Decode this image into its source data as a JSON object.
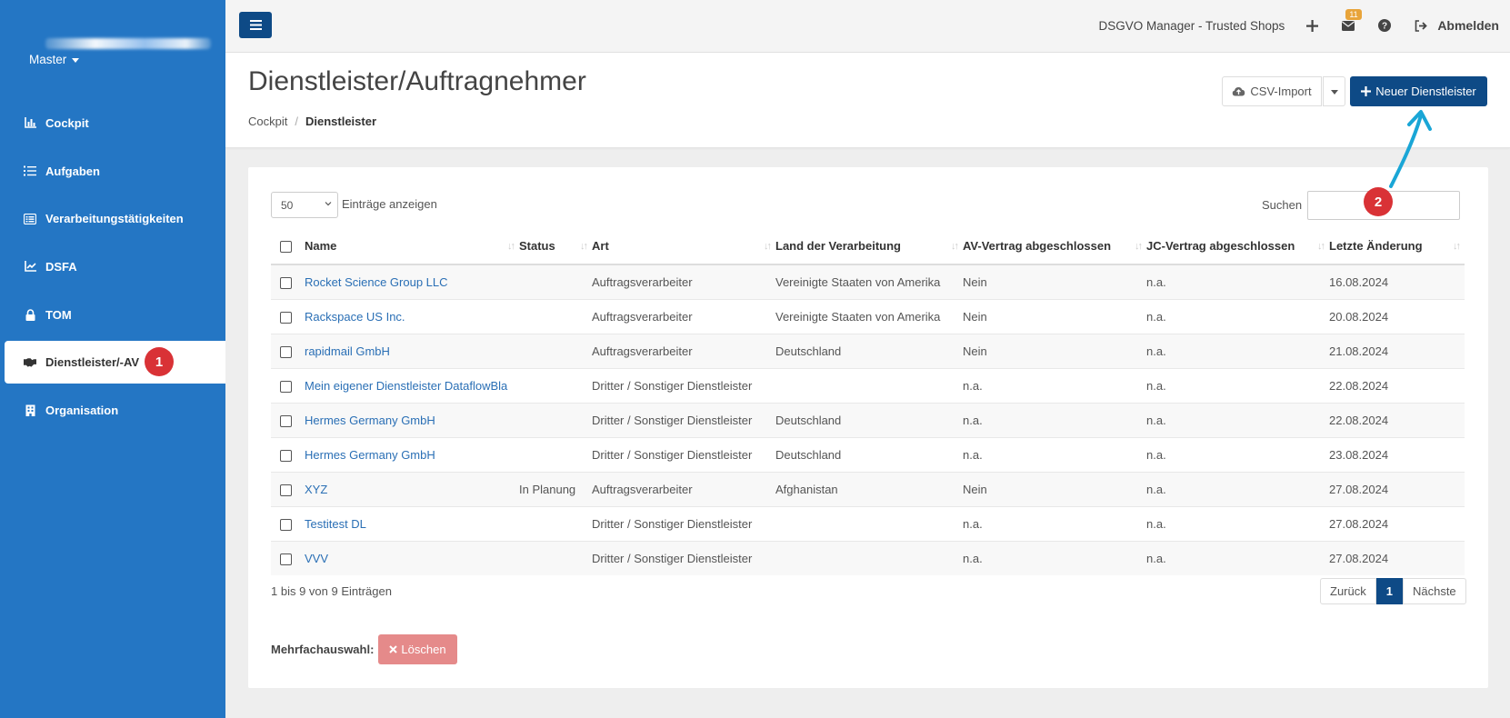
{
  "sidebar": {
    "account": "Master",
    "items": [
      {
        "label": "Cockpit",
        "icon": "chart-bar-icon"
      },
      {
        "label": "Aufgaben",
        "icon": "list-check-icon"
      },
      {
        "label": "Verarbeitungstätigkeiten",
        "icon": "list-icon"
      },
      {
        "label": "DSFA",
        "icon": "chart-line-icon"
      },
      {
        "label": "TOM",
        "icon": "lock-icon"
      },
      {
        "label": "Dienstleister/-AV",
        "icon": "handshake-icon",
        "active": true
      },
      {
        "label": "Organisation",
        "icon": "building-icon"
      }
    ],
    "step_badge": "1"
  },
  "topbar": {
    "app_link": "DSGVO Manager - Trusted Shops",
    "mail_count": "11",
    "logout_label": "Abmelden"
  },
  "header": {
    "title": "Dienstleister/Auftragnehmer",
    "breadcrumb": {
      "home": "Cockpit",
      "separator": "/",
      "current": "Dienstleister"
    },
    "csv_label": "CSV-Import",
    "new_label": "Neuer Dienstleister",
    "step_badge": "2"
  },
  "table_controls": {
    "page_length": "50",
    "page_length_label": "Einträge anzeigen",
    "search_label": "Suchen"
  },
  "table": {
    "columns": [
      "Name",
      "Status",
      "Art",
      "Land der Verarbeitung",
      "AV-Vertrag abgeschlossen",
      "JC-Vertrag abgeschlossen",
      "Letzte Änderung"
    ],
    "rows": [
      [
        "Rocket Science Group LLC",
        "",
        "Auftragsverarbeiter",
        "Vereinigte Staaten von Amerika",
        "Nein",
        "n.a.",
        "16.08.2024"
      ],
      [
        "Rackspace US Inc.",
        "",
        "Auftragsverarbeiter",
        "Vereinigte Staaten von Amerika",
        "Nein",
        "n.a.",
        "20.08.2024"
      ],
      [
        "rapidmail GmbH",
        "",
        "Auftragsverarbeiter",
        "Deutschland",
        "Nein",
        "n.a.",
        "21.08.2024"
      ],
      [
        "Mein eigener Dienstleister DataflowBla",
        "",
        "Dritter / Sonstiger Dienstleister",
        "",
        "n.a.",
        "n.a.",
        "22.08.2024"
      ],
      [
        "Hermes Germany GmbH",
        "",
        "Dritter / Sonstiger Dienstleister",
        "Deutschland",
        "n.a.",
        "n.a.",
        "22.08.2024"
      ],
      [
        "Hermes Germany GmbH",
        "",
        "Dritter / Sonstiger Dienstleister",
        "Deutschland",
        "n.a.",
        "n.a.",
        "23.08.2024"
      ],
      [
        "XYZ",
        "In Planung",
        "Auftragsverarbeiter",
        "Afghanistan",
        "Nein",
        "n.a.",
        "27.08.2024"
      ],
      [
        "Testitest DL",
        "",
        "Dritter / Sonstiger Dienstleister",
        "",
        "n.a.",
        "n.a.",
        "27.08.2024"
      ],
      [
        "VVV",
        "",
        "Dritter / Sonstiger Dienstleister",
        "",
        "n.a.",
        "n.a.",
        "27.08.2024"
      ]
    ]
  },
  "footer": {
    "info": "1 bis 9 von 9 Einträgen",
    "prev": "Zurück",
    "page": "1",
    "next": "Nächste",
    "multi_label": "Mehrfachauswahl:",
    "delete_label": "Löschen"
  },
  "colors": {
    "sidebar": "#2476c4",
    "primary": "#0e4a86",
    "link": "#2a6fb5",
    "badge": "#d93236",
    "danger_soft": "#e58a8a",
    "annotation_arrow": "#1aa6d6"
  }
}
